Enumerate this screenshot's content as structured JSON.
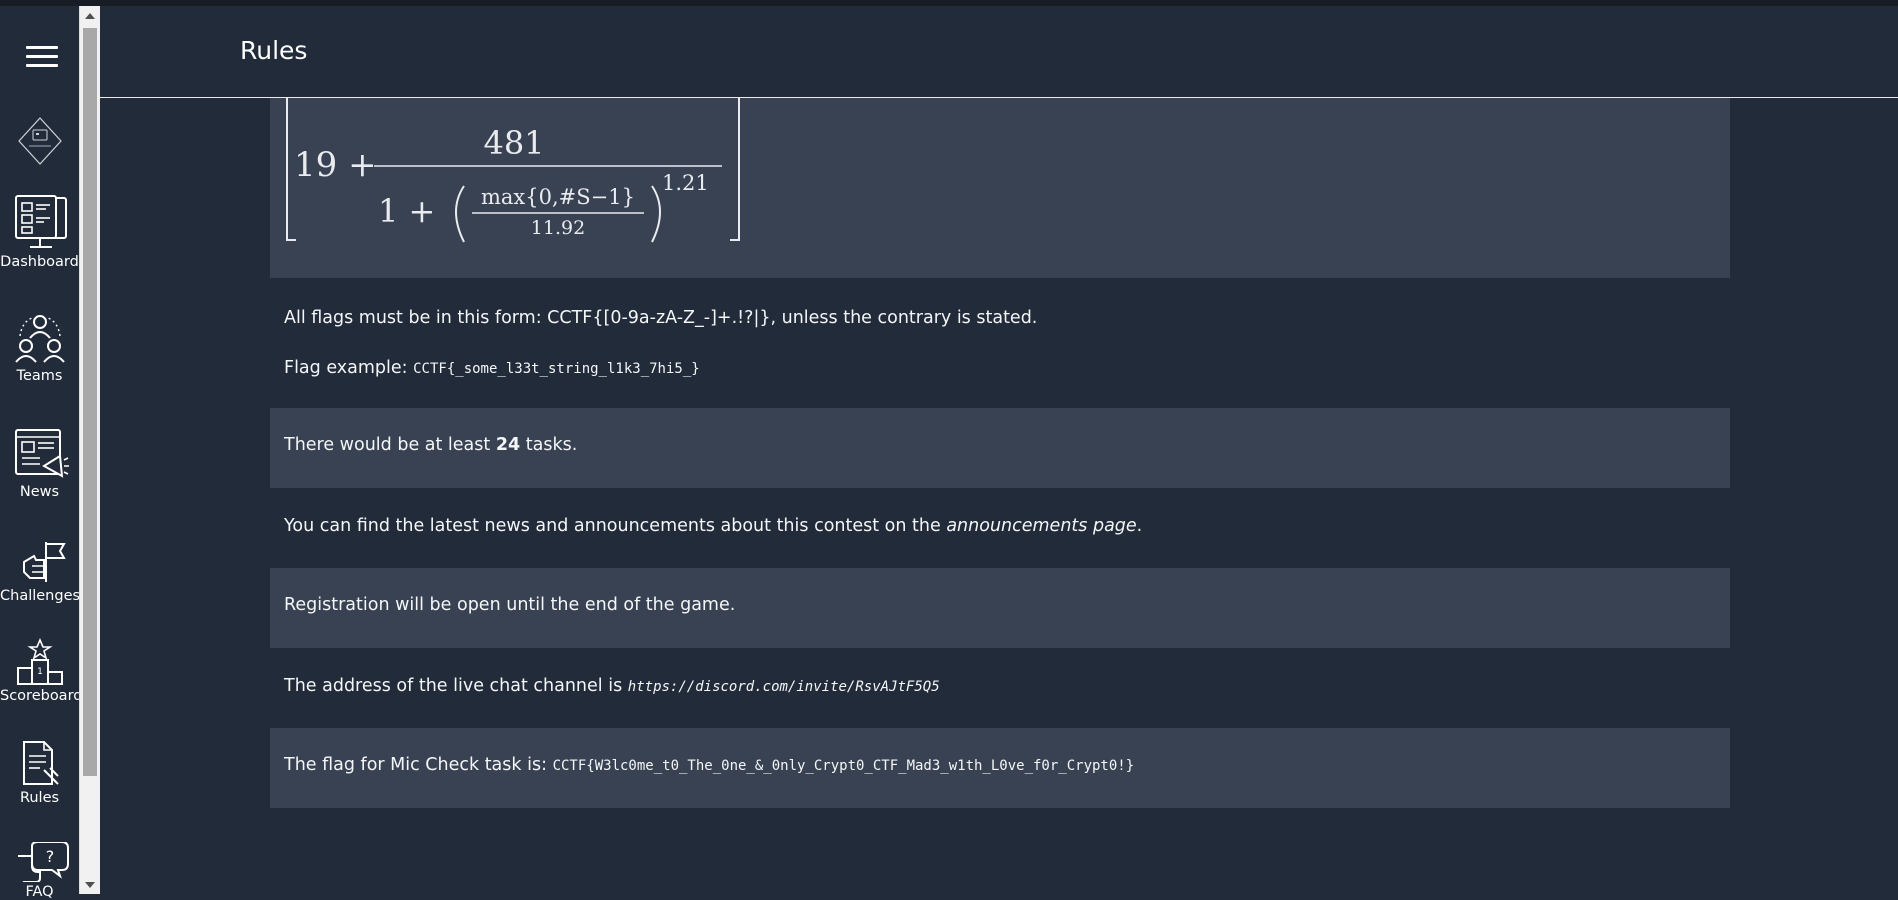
{
  "header": {
    "title": "Rules"
  },
  "sidebar": {
    "items": [
      {
        "label": "Dashboard"
      },
      {
        "label": "Teams"
      },
      {
        "label": "News"
      },
      {
        "label": "Challenges"
      },
      {
        "label": "Scoreboard"
      },
      {
        "label": "Rules"
      },
      {
        "label": "FAQ"
      }
    ]
  },
  "formula": {
    "base": "19 +",
    "numerator": "481",
    "den_prefix": "1 +",
    "inner_num": "max{0,#S−1}",
    "inner_den": "11.92",
    "exponent": "1.21"
  },
  "rules": {
    "flag_format_text": "All flags must be in this form: CCTF{[0-9a-zA-Z_-]+.!?|}, unless the contrary is stated.",
    "flag_example_label": "Flag example:",
    "flag_example_value": "CCTF{_some_l33t_string_l1k3_7hi5_}",
    "tasks_prefix": "There would be at least",
    "tasks_count": "24",
    "tasks_suffix": "tasks.",
    "news_prefix": "You can find the latest news and announcements about this contest on the",
    "news_link": "announcements page",
    "news_suffix": ".",
    "registration_text": "Registration will be open until the end of the game.",
    "chat_prefix": "The address of the live chat channel is",
    "chat_link": "https://discord.com/invite/RsvAJtF5Q5",
    "mic_prefix": "The flag for Mic Check task is:",
    "mic_flag": "CCTF{W3lc0me_t0_The_0ne_&_0nly_Crypt0_CTF_Mad3_w1th_L0ve_f0r_Crypt0!}"
  },
  "colors": {
    "background": "#222b39",
    "band": "#384253"
  }
}
